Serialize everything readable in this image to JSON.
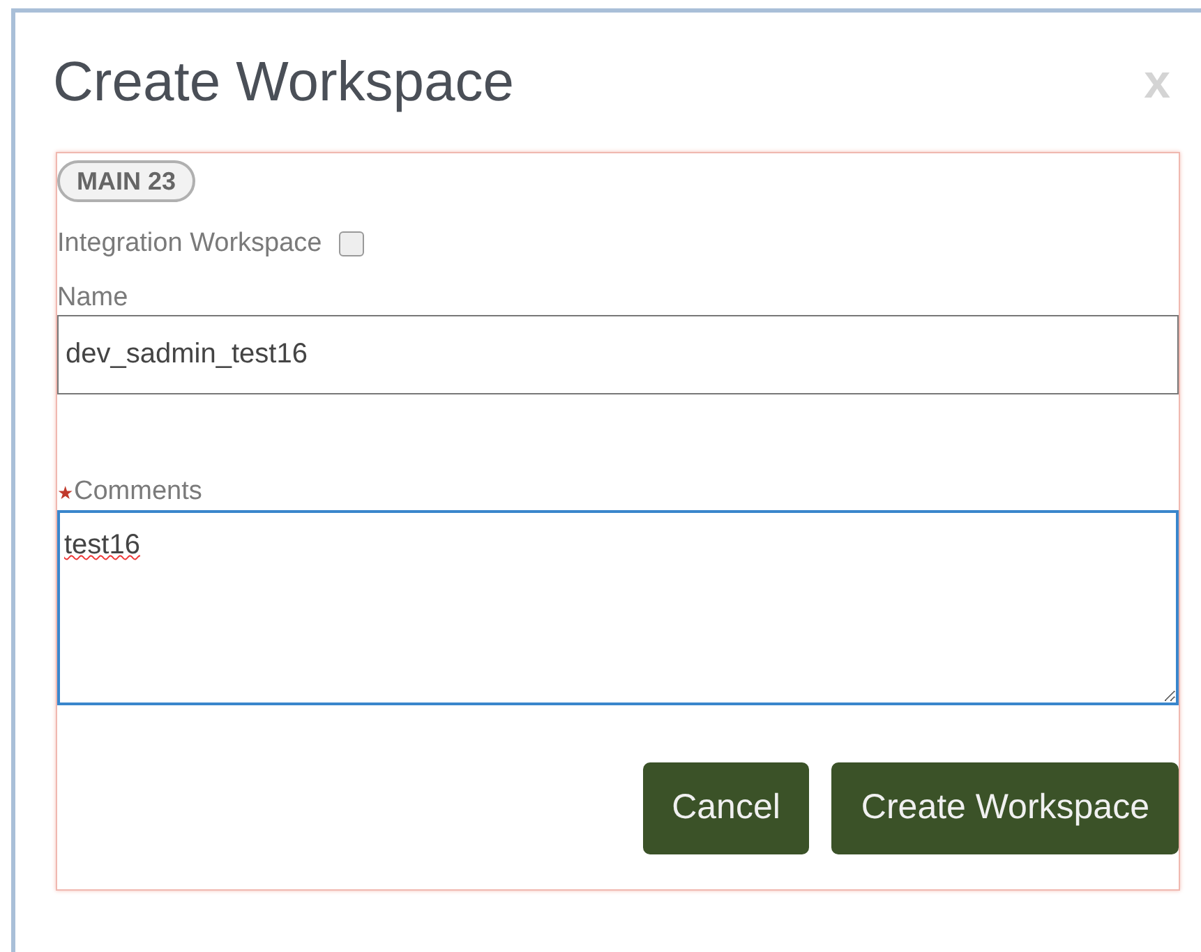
{
  "dialog": {
    "title": "Create Workspace",
    "close": "x"
  },
  "badge": "MAIN 23",
  "integration": {
    "label": "Integration Workspace",
    "checked": false
  },
  "name": {
    "label": "Name",
    "value": "dev_sadmin_test16"
  },
  "comments": {
    "label": "Comments",
    "required": true,
    "required_mark": "★",
    "value": "test16"
  },
  "buttons": [
    "Cancel",
    "Create Workspace"
  ]
}
